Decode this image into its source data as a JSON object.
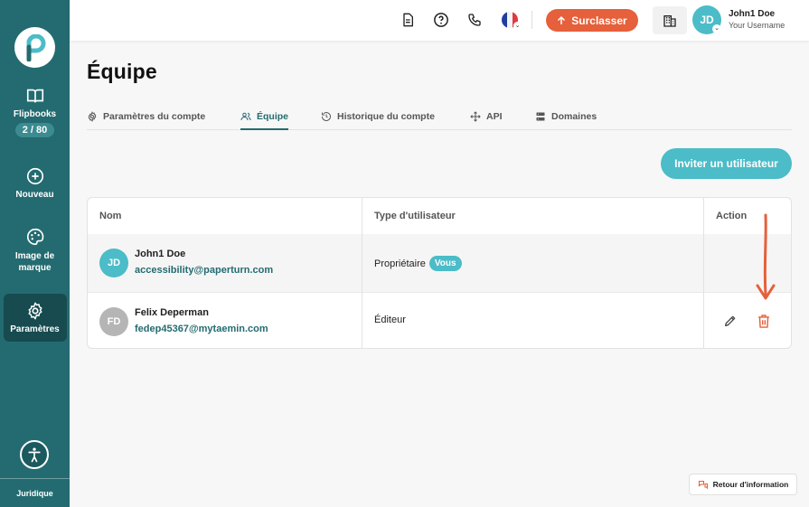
{
  "sidebar": {
    "items": [
      {
        "label": "Flipbooks",
        "count": "2 / 80",
        "icon": "book-open-icon"
      },
      {
        "label": "Nouveau",
        "icon": "plus-circle-icon"
      },
      {
        "label": "Image de marque",
        "icon": "palette-icon"
      },
      {
        "label": "Paramètres",
        "icon": "gear-icon",
        "active": true
      }
    ],
    "legal_label": "Juridique"
  },
  "topbar": {
    "upgrade_label": "Surclasser",
    "user": {
      "initials": "JD",
      "name": "John1 Doe",
      "subtitle": "Your Username"
    },
    "language": "fr"
  },
  "page": {
    "title": "Équipe",
    "tabs": [
      {
        "label": "Paramètres du compte",
        "icon": "gear-icon"
      },
      {
        "label": "Équipe",
        "icon": "users-icon",
        "active": true
      },
      {
        "label": "Historique du compte",
        "icon": "history-icon"
      },
      {
        "label": "API",
        "icon": "move-icon"
      },
      {
        "label": "Domaines",
        "icon": "server-icon"
      }
    ],
    "invite_label": "Inviter un utilisateur"
  },
  "table": {
    "headers": [
      "Nom",
      "Type d'utilisateur",
      "Action"
    ],
    "rows": [
      {
        "initials": "JD",
        "name": "John1 Doe",
        "email": "accessibility@paperturn.com",
        "type": "Propriétaire",
        "badge": "Vous",
        "avatar_color": "#4bbcc8"
      },
      {
        "initials": "FD",
        "name": "Felix Deperman",
        "email": "fedep45367@mytaemin.com",
        "type": "Éditeur",
        "avatar_color": "#b5b5b5"
      }
    ]
  },
  "feedback_label": "Retour d'information",
  "colors": {
    "sidebar": "#236b70",
    "accent": "#4bbcc8",
    "upgrade": "#e5603b",
    "annotation": "#e5603b"
  }
}
